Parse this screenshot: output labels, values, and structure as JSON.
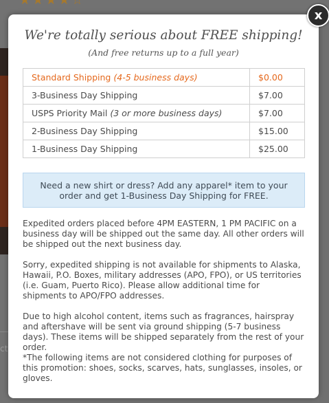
{
  "modal": {
    "headline": "We're totally serious about FREE shipping!",
    "subhead": "(And free returns up to a full year)",
    "close_label": "x",
    "shipping_options": [
      {
        "name": "Standard Shipping",
        "detail": "(4-5 business days)",
        "price": "$0.00",
        "highlighted": true
      },
      {
        "name": "3-Business Day Shipping",
        "detail": "",
        "price": "$7.00",
        "highlighted": false
      },
      {
        "name": "USPS Priority Mail",
        "detail": "(3 or more business days)",
        "price": "$7.00",
        "highlighted": false
      },
      {
        "name": "2-Business Day Shipping",
        "detail": "",
        "price": "$15.00",
        "highlighted": false
      },
      {
        "name": "1-Business Day Shipping",
        "detail": "",
        "price": "$25.00",
        "highlighted": false
      }
    ],
    "note": "Need a new shirt or dress? Add any apparel* item to your order and get 1-Business Day Shipping for FREE.",
    "paragraphs": [
      "Expedited orders placed before 4PM EASTERN, 1 PM PACIFIC on a business day will be shipped out the same day. All other orders will be shipped out the next business day.",
      "Sorry, expedited shipping is not available for shipments to Alaska, Hawaii, P.O. Boxes, military addresses (APO, FPO), or US territories (i.e. Guam, Puerto Rico). Please allow additional time for shipments to APO/FPO addresses.",
      "Due to high alcohol content, items such as fragrances, hairspray and aftershave will be sent via ground shipping (5-7 business days). These items will be shipped separately from the rest of your order.",
      "*The following items are not considered clothing for purposes of this promotion: shoes, socks, scarves, hats, sunglasses, insoles, or gloves."
    ]
  },
  "background": {
    "rating_stars": "★★★★☆",
    "fragment_text": "ct"
  },
  "colors": {
    "highlight": "#e5681c",
    "note_bg": "#dcecf8",
    "overlay": "#6d6d6d"
  }
}
